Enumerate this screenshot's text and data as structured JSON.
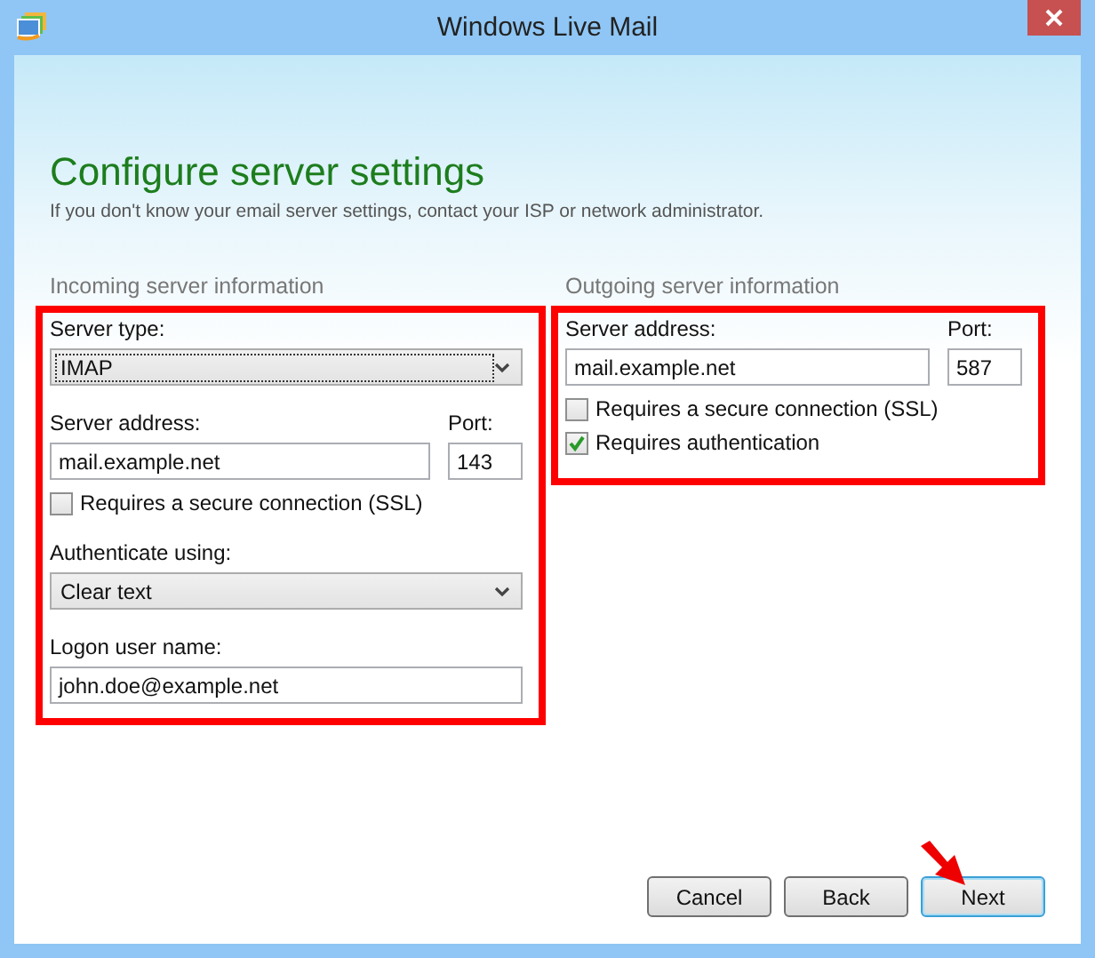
{
  "window": {
    "title": "Windows Live Mail"
  },
  "heading": "Configure server settings",
  "subtitle": "If you don't know your email server settings, contact your ISP or network administrator.",
  "sections": [
    {
      "title": "Incoming server information",
      "highlighted": true,
      "items": [
        {
          "kind": "select",
          "label": "Server type:",
          "value": "IMAP",
          "focused": true
        },
        {
          "kind": "address",
          "label": "Server address:",
          "value": "mail.example.net",
          "port_label": "Port:",
          "port": "143"
        },
        {
          "kind": "checkbox",
          "label": "Requires a secure connection (SSL)",
          "checked": false
        },
        {
          "kind": "select",
          "label": "Authenticate using:",
          "value": "Clear text",
          "focused": false
        },
        {
          "kind": "text",
          "label": "Logon user name:",
          "value": "john.doe@example.net"
        }
      ]
    },
    {
      "title": "Outgoing server information",
      "highlighted": true,
      "items": [
        {
          "kind": "address",
          "label": "Server address:",
          "value": "mail.example.net",
          "port_label": "Port:",
          "port": "587"
        },
        {
          "kind": "checkbox",
          "label": "Requires a secure connection (SSL)",
          "checked": false
        },
        {
          "kind": "checkbox",
          "label": "Requires authentication",
          "checked": true
        }
      ]
    }
  ],
  "buttons": [
    {
      "label": "Cancel",
      "focused": false
    },
    {
      "label": "Back",
      "focused": false
    },
    {
      "label": "Next",
      "focused": true
    }
  ],
  "pointer_arrow": true
}
